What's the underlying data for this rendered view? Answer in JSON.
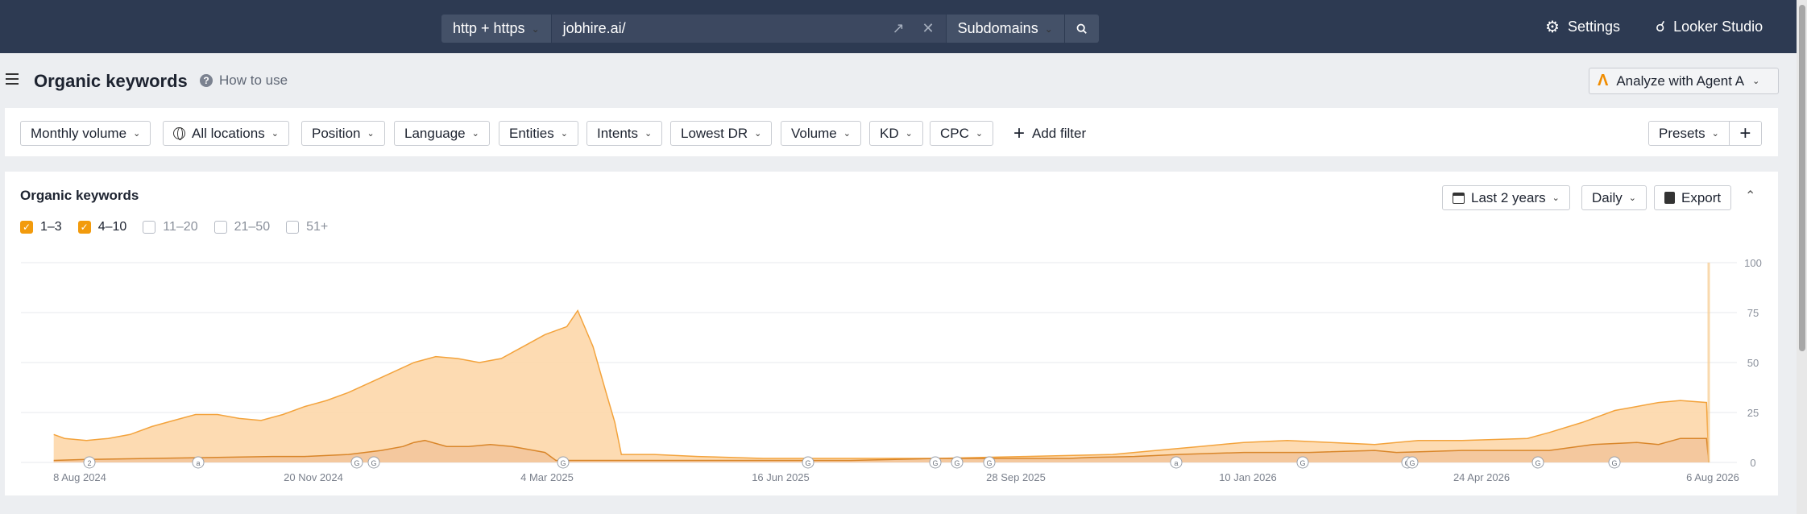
{
  "topbar": {
    "protocol": "http + https",
    "url": "jobhire.ai/",
    "scope": "Subdomains",
    "settings": "Settings",
    "looker": "Looker Studio"
  },
  "header": {
    "title": "Organic keywords",
    "how_to_use": "How to use",
    "agent_button": "Analyze with Agent A"
  },
  "filters": {
    "monthly_volume": "Monthly volume",
    "all_locations": "All locations",
    "position": "Position",
    "language": "Language",
    "entities": "Entities",
    "intents": "Intents",
    "lowest_dr": "Lowest DR",
    "volume": "Volume",
    "kd": "KD",
    "cpc": "CPC",
    "add_filter": "Add filter",
    "presets": "Presets"
  },
  "card": {
    "title": "Organic keywords",
    "period": "Last 2 years",
    "granularity": "Daily",
    "export": "Export",
    "legend": [
      {
        "label": "1–3",
        "checked": true
      },
      {
        "label": "4–10",
        "checked": true
      },
      {
        "label": "11–20",
        "checked": false
      },
      {
        "label": "21–50",
        "checked": false
      },
      {
        "label": "51+",
        "checked": false
      }
    ]
  },
  "colors": {
    "topbar": "#2d3a52",
    "series_4_10_fill": "#fdd5a5",
    "series_4_10_line": "#f3a33c",
    "series_1_3_fill": "#f2c49a",
    "series_1_3_line": "#d9862a",
    "checkbox_on": "#f29b0d"
  },
  "chart_data": {
    "type": "area",
    "stacked": true,
    "x_tick_labels": [
      "8 Aug 2024",
      "20 Nov 2024",
      "4 Mar 2025",
      "16 Jun 2025",
      "28 Sep 2025",
      "10 Jan 2026",
      "24 Apr 2026",
      "6 Aug 2026"
    ],
    "y_tick_labels": [
      "0",
      "25",
      "50",
      "75",
      "100"
    ],
    "ylim": [
      0,
      100
    ],
    "y_axis_side": "right",
    "grid": true,
    "x_unit": "days since 2024-07-23",
    "series": [
      {
        "name": "1–3",
        "points": [
          [
            15,
            1
          ],
          [
            30,
            1.5
          ],
          [
            60,
            2
          ],
          [
            90,
            2.5
          ],
          [
            115,
            3
          ],
          [
            130,
            3
          ],
          [
            150,
            4
          ],
          [
            165,
            6
          ],
          [
            175,
            8
          ],
          [
            180,
            10
          ],
          [
            185,
            11
          ],
          [
            195,
            8
          ],
          [
            205,
            8
          ],
          [
            215,
            9
          ],
          [
            225,
            8
          ],
          [
            235,
            6
          ],
          [
            240,
            5
          ],
          [
            245,
            1
          ],
          [
            250,
            1
          ],
          [
            280,
            1
          ],
          [
            330,
            1
          ],
          [
            380,
            1
          ],
          [
            420,
            2
          ],
          [
            460,
            2
          ],
          [
            480,
            2
          ],
          [
            490,
            2.5
          ],
          [
            510,
            3
          ],
          [
            530,
            4
          ],
          [
            560,
            5
          ],
          [
            590,
            5
          ],
          [
            620,
            6
          ],
          [
            630,
            5
          ],
          [
            660,
            6
          ],
          [
            700,
            6
          ],
          [
            720,
            9
          ],
          [
            740,
            10
          ],
          [
            750,
            9
          ],
          [
            760,
            12
          ],
          [
            765,
            12
          ],
          [
            772,
            12
          ],
          [
            773,
            0
          ]
        ]
      },
      {
        "name": "4–10",
        "points": [
          [
            15,
            14
          ],
          [
            20,
            12
          ],
          [
            30,
            11
          ],
          [
            40,
            12
          ],
          [
            50,
            14
          ],
          [
            60,
            18
          ],
          [
            70,
            21
          ],
          [
            80,
            24
          ],
          [
            90,
            24
          ],
          [
            100,
            22
          ],
          [
            110,
            21
          ],
          [
            120,
            24
          ],
          [
            130,
            28
          ],
          [
            140,
            31
          ],
          [
            150,
            35
          ],
          [
            160,
            40
          ],
          [
            170,
            45
          ],
          [
            180,
            50
          ],
          [
            190,
            53
          ],
          [
            200,
            52
          ],
          [
            210,
            50
          ],
          [
            220,
            52
          ],
          [
            230,
            58
          ],
          [
            240,
            64
          ],
          [
            250,
            68
          ],
          [
            255,
            76
          ],
          [
            262,
            58
          ],
          [
            268,
            35
          ],
          [
            272,
            20
          ],
          [
            275,
            4
          ],
          [
            280,
            4
          ],
          [
            290,
            4
          ],
          [
            310,
            3
          ],
          [
            340,
            2
          ],
          [
            380,
            2
          ],
          [
            420,
            2
          ],
          [
            460,
            3
          ],
          [
            500,
            4
          ],
          [
            520,
            6
          ],
          [
            540,
            8
          ],
          [
            560,
            10
          ],
          [
            580,
            11
          ],
          [
            600,
            10
          ],
          [
            620,
            9
          ],
          [
            640,
            11
          ],
          [
            660,
            11
          ],
          [
            690,
            12
          ],
          [
            700,
            15
          ],
          [
            715,
            20
          ],
          [
            730,
            26
          ],
          [
            740,
            28
          ],
          [
            750,
            30
          ],
          [
            760,
            31
          ],
          [
            772,
            30
          ],
          [
            773,
            0
          ]
        ]
      }
    ],
    "annotation_markers": [
      "2",
      "a",
      "G",
      "G",
      "G",
      "G",
      "G",
      "G",
      "G",
      "a",
      "G",
      "G",
      "G",
      "G",
      "G",
      "G"
    ]
  }
}
